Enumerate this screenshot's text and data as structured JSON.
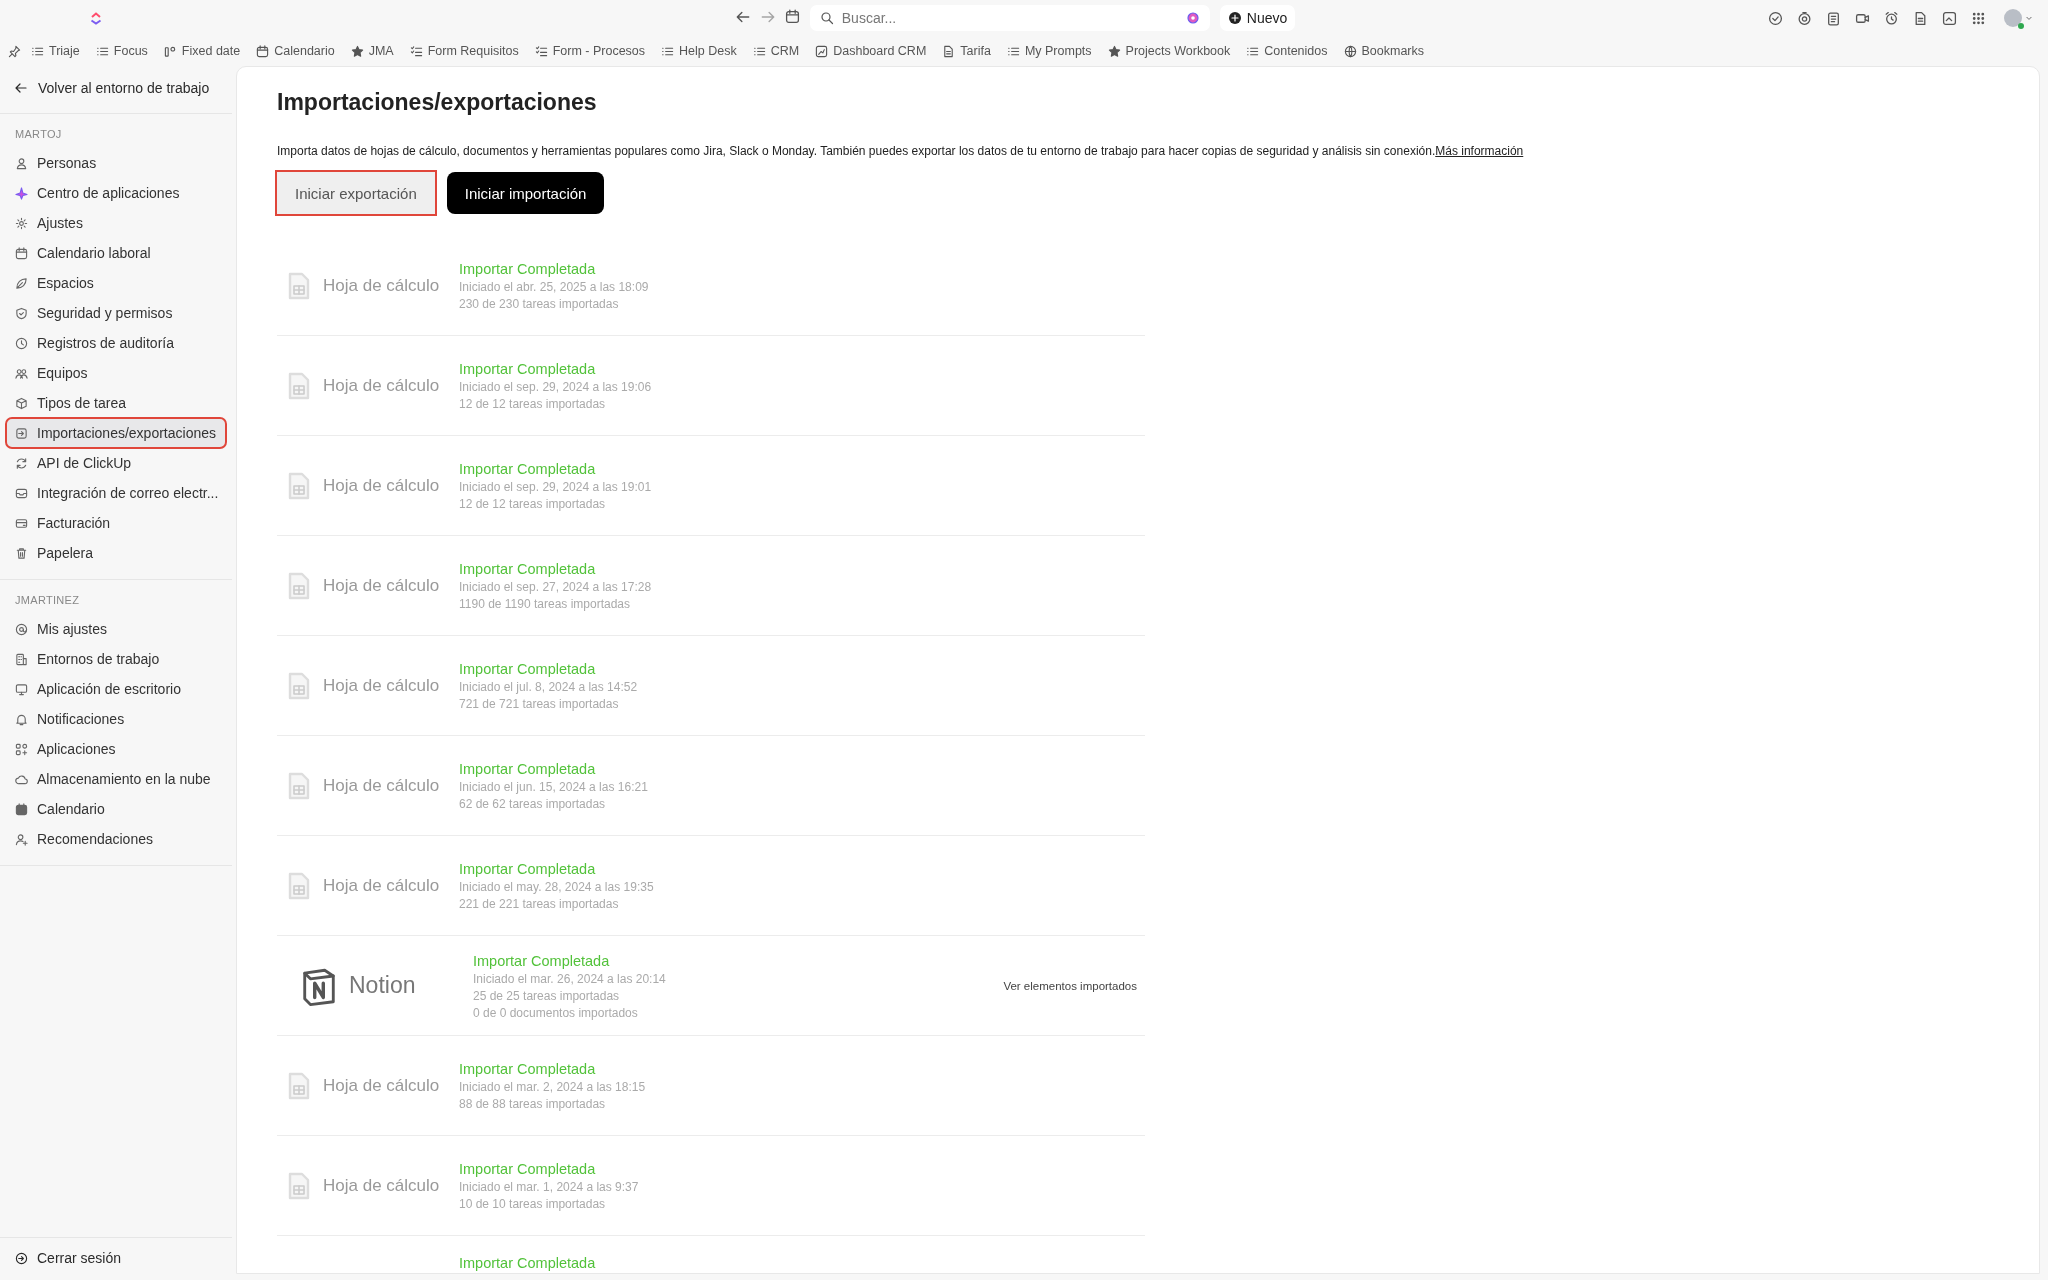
{
  "topbar": {
    "search": {
      "placeholder": "Buscar..."
    },
    "new_button": "Nuevo"
  },
  "bookmarks": [
    "Triaje",
    "Focus",
    "Fixed date",
    "Calendario",
    "JMA",
    "Form Requisitos",
    "Form - Procesos",
    "Help Desk",
    "CRM",
    "Dashboard CRM",
    "Tarifa",
    "My Prompts",
    "Projects Workbook",
    "Contenidos",
    "Bookmarks"
  ],
  "sidebar": {
    "back": "Volver al entorno de trabajo",
    "sections": [
      {
        "title": "MARTOJ",
        "items": [
          {
            "label": "Personas",
            "selected": false,
            "outlined": false
          },
          {
            "label": "Centro de aplicaciones",
            "selected": false,
            "outlined": false
          },
          {
            "label": "Ajustes",
            "selected": false,
            "outlined": false
          },
          {
            "label": "Calendario laboral",
            "selected": false,
            "outlined": false
          },
          {
            "label": "Espacios",
            "selected": false,
            "outlined": false
          },
          {
            "label": "Seguridad y permisos",
            "selected": false,
            "outlined": false
          },
          {
            "label": "Registros de auditoría",
            "selected": false,
            "outlined": false
          },
          {
            "label": "Equipos",
            "selected": false,
            "outlined": false
          },
          {
            "label": "Tipos de tarea",
            "selected": false,
            "outlined": false
          },
          {
            "label": "Importaciones/exportaciones",
            "selected": true,
            "outlined": true
          },
          {
            "label": "API de ClickUp",
            "selected": false,
            "outlined": false
          },
          {
            "label": "Integración de correo electr...",
            "selected": false,
            "outlined": false
          },
          {
            "label": "Facturación",
            "selected": false,
            "outlined": false
          },
          {
            "label": "Papelera",
            "selected": false,
            "outlined": false
          }
        ]
      },
      {
        "title": "JMARTINEZ",
        "items": [
          {
            "label": "Mis ajustes",
            "selected": false,
            "outlined": false
          },
          {
            "label": "Entornos de trabajo",
            "selected": false,
            "outlined": false
          },
          {
            "label": "Aplicación de escritorio",
            "selected": false,
            "outlined": false
          },
          {
            "label": "Notificaciones",
            "selected": false,
            "outlined": false
          },
          {
            "label": "Aplicaciones",
            "selected": false,
            "outlined": false
          },
          {
            "label": "Almacenamiento en la nube",
            "selected": false,
            "outlined": false
          },
          {
            "label": "Calendario",
            "selected": false,
            "outlined": false
          },
          {
            "label": "Recomendaciones",
            "selected": false,
            "outlined": false
          }
        ]
      }
    ],
    "footer": "Cerrar sesión"
  },
  "main": {
    "title": "Importaciones/exportaciones",
    "description": {
      "text": "Importa datos de hojas de cálculo, documentos y herramientas populares como Jira, Slack o Monday. También puedes exportar los datos de tu entorno de trabajo para hacer copias de seguridad y análisis sin conexión.",
      "link": "Más información"
    },
    "actions": [
      {
        "label": "Iniciar exportación",
        "kind": "secondary",
        "outlined": true
      },
      {
        "label": "Iniciar importación",
        "kind": "primary",
        "outlined": false
      }
    ],
    "imports": [
      {
        "kind": "spreadsheet",
        "source": "Hoja de cálculo",
        "status": "Importar Completada",
        "details": [
          "Iniciado el abr. 25, 2025 a las 18:09",
          "230 de 230 tareas importadas"
        ]
      },
      {
        "kind": "spreadsheet",
        "source": "Hoja de cálculo",
        "status": "Importar Completada",
        "details": [
          "Iniciado el sep. 29, 2024 a las 19:06",
          "12 de 12 tareas importadas"
        ]
      },
      {
        "kind": "spreadsheet",
        "source": "Hoja de cálculo",
        "status": "Importar Completada",
        "details": [
          "Iniciado el sep. 29, 2024 a las 19:01",
          "12 de 12 tareas importadas"
        ]
      },
      {
        "kind": "spreadsheet",
        "source": "Hoja de cálculo",
        "status": "Importar Completada",
        "details": [
          "Iniciado el sep. 27, 2024 a las 17:28",
          "1190 de 1190 tareas importadas"
        ]
      },
      {
        "kind": "spreadsheet",
        "source": "Hoja de cálculo",
        "status": "Importar Completada",
        "details": [
          "Iniciado el jul. 8, 2024 a las 14:52",
          "721 de 721 tareas importadas"
        ]
      },
      {
        "kind": "spreadsheet",
        "source": "Hoja de cálculo",
        "status": "Importar Completada",
        "details": [
          "Iniciado el jun. 15, 2024 a las 16:21",
          "62 de 62 tareas importadas"
        ]
      },
      {
        "kind": "spreadsheet",
        "source": "Hoja de cálculo",
        "status": "Importar Completada",
        "details": [
          "Iniciado el may. 28, 2024 a las 19:35",
          "221 de 221 tareas importadas"
        ]
      },
      {
        "kind": "notion",
        "source": "Notion",
        "status": "Importar Completada",
        "details": [
          "Iniciado el mar. 26, 2024 a las 20:14",
          "25 de 25 tareas importadas",
          "0 de 0 documentos importados"
        ],
        "action": "Ver elementos importados"
      },
      {
        "kind": "spreadsheet",
        "source": "Hoja de cálculo",
        "status": "Importar Completada",
        "details": [
          "Iniciado el mar. 2, 2024 a las 18:15",
          "88 de 88 tareas importadas"
        ]
      },
      {
        "kind": "spreadsheet",
        "source": "Hoja de cálculo",
        "status": "Importar Completada",
        "details": [
          "Iniciado el mar. 1, 2024 a las 9:37",
          "10 de 10 tareas importadas"
        ]
      },
      {
        "kind": "cut",
        "status": "Importar Completada"
      }
    ]
  }
}
